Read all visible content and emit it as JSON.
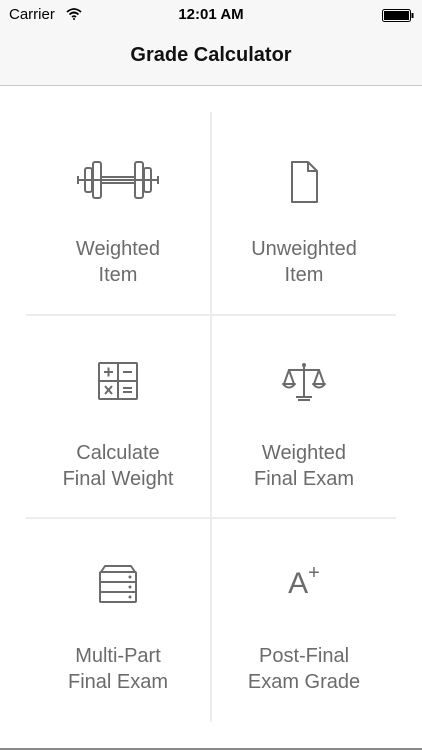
{
  "status_bar": {
    "carrier": "Carrier",
    "time": "12:01 AM"
  },
  "nav": {
    "title": "Grade Calculator"
  },
  "colors": {
    "icon_gray": "#6b6b6b",
    "bar_background": "#f7f7f7",
    "grid_line": "#ececec"
  },
  "grid": {
    "items": [
      {
        "icon": "barbell-icon",
        "line1": "Weighted",
        "line2": "Item"
      },
      {
        "icon": "document-icon",
        "line1": "Unweighted",
        "line2": "Item"
      },
      {
        "icon": "calculator-icon",
        "line1": "Calculate",
        "line2": "Final Weight"
      },
      {
        "icon": "scale-icon",
        "line1": "Weighted",
        "line2": "Final Exam"
      },
      {
        "icon": "stack-icon",
        "line1": "Multi-Part",
        "line2": "Final Exam"
      },
      {
        "icon": "a-plus-icon",
        "icon_text": "A",
        "icon_sup": "+",
        "line1": "Post-Final",
        "line2": "Exam Grade"
      }
    ]
  }
}
